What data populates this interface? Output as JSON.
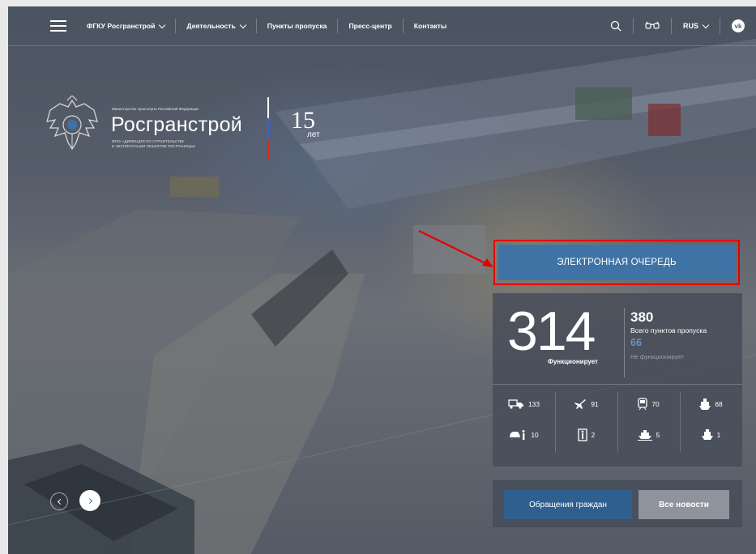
{
  "header": {
    "nav": [
      {
        "label": "ФГКУ Росгранстрой",
        "dropdown": true
      },
      {
        "label": "Деятельность",
        "dropdown": true
      },
      {
        "label": "Пункты пропуска",
        "dropdown": false
      },
      {
        "label": "Пресс-центр",
        "dropdown": false
      },
      {
        "label": "Контакты",
        "dropdown": false
      }
    ],
    "language": "RUS",
    "icons": [
      "menu-icon",
      "search-icon",
      "accessibility-glasses-icon",
      "vk-icon"
    ],
    "vk_glyph": "vk"
  },
  "logo": {
    "ministry": "Министерство транспорта Российской Федерации",
    "brand": "Росгранстрой",
    "subtitle_line1": "ФГКУ «ДИРЕКЦИЯ ПО СТРОИТЕЛЬСТВУ",
    "subtitle_line2": "И ЭКСПЛУАТАЦИИ ОБЪЕКТОВ РОСГРАНИЦЫ»",
    "anniversary_number": "15",
    "anniversary_unit": "лет",
    "flag_colors": [
      "#ffffff",
      "#3b63c8",
      "#d52b1e"
    ]
  },
  "queue": {
    "label": "ЭЛЕКТРОННАЯ ОЧЕРЕДЬ",
    "highlight_color": "#e40000"
  },
  "stats": {
    "functioning_count": "314",
    "functioning_label": "Функционирует",
    "total_count": "380",
    "total_label": "Всего пунктов пропуска",
    "not_functioning_count": "66",
    "not_functioning_label": "Не функционирует",
    "categories": [
      {
        "icon": "car-truck-icon",
        "count": "133"
      },
      {
        "icon": "airplane-icon",
        "count": "91"
      },
      {
        "icon": "train-icon",
        "count": "70"
      },
      {
        "icon": "ship-icon",
        "count": "68"
      },
      {
        "icon": "car-pedestrian-icon",
        "count": "10"
      },
      {
        "icon": "pedestrian-door-icon",
        "count": "2"
      },
      {
        "icon": "ferry-icon",
        "count": "5"
      },
      {
        "icon": "river-boat-icon",
        "count": "1"
      }
    ]
  },
  "actions": {
    "citizens_label": "Обращения граждан",
    "news_label": "Все новости"
  },
  "colors": {
    "primary_blue": "#3f73a6",
    "dark_blue": "#2f5f8f",
    "muted_blue": "#6d93c4",
    "panel": "#464c58",
    "grey_button": "#8f939c"
  }
}
